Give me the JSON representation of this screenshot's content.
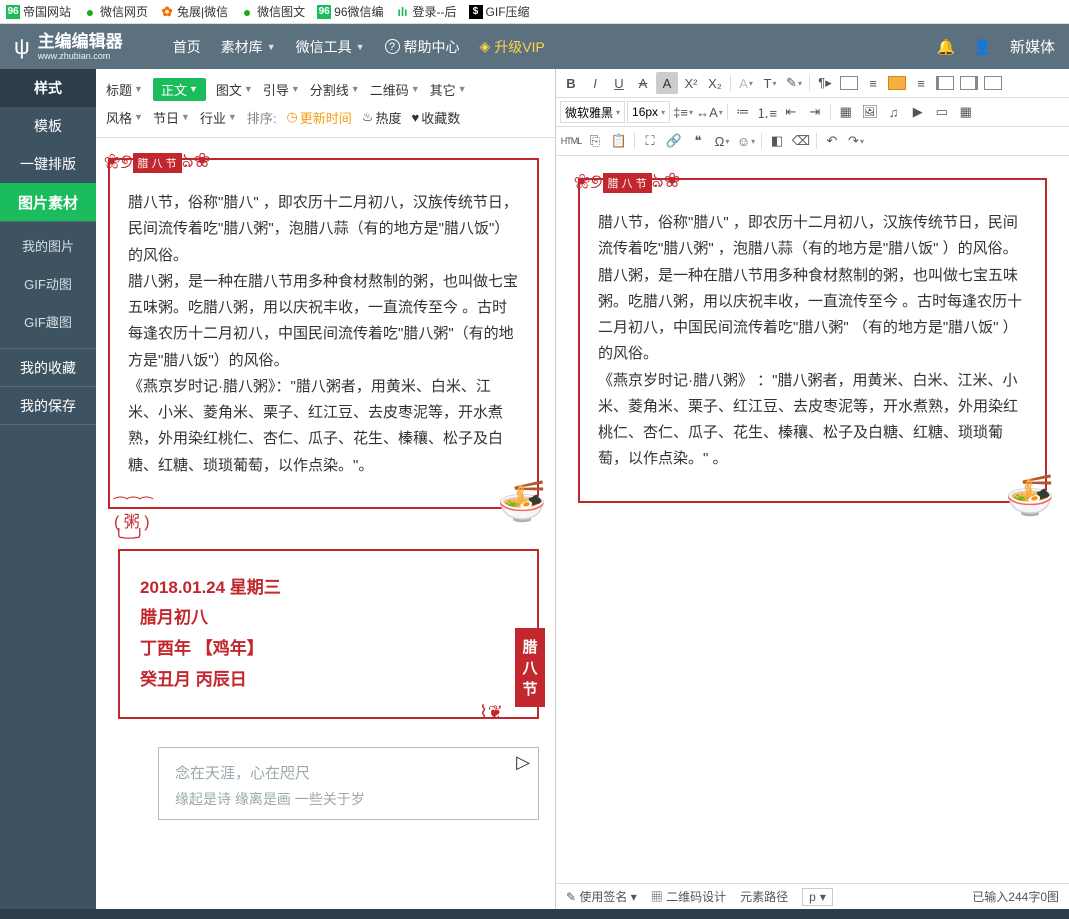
{
  "bookmarks": [
    {
      "label": "帝国网站",
      "icon": "96",
      "cls": "g96"
    },
    {
      "label": "微信网页",
      "icon": "●",
      "cls": "wx"
    },
    {
      "label": "兔展|微信",
      "icon": "✿",
      "cls": "or"
    },
    {
      "label": "微信图文",
      "icon": "●",
      "cls": "wx"
    },
    {
      "label": "96微信编",
      "icon": "96",
      "cls": "g96"
    },
    {
      "label": "登录--后",
      "icon": "ılı",
      "cls": "bars"
    },
    {
      "label": "GIF压缩",
      "icon": "$",
      "cls": "blk"
    }
  ],
  "brand": {
    "title": "主编编辑器",
    "sub": "www.zhubian.com"
  },
  "nav": {
    "home": "首页",
    "materials": "素材库",
    "wxtools": "微信工具",
    "help": "帮助中心",
    "vip": "升级VIP",
    "newmedia": "新媒体"
  },
  "sidebar": {
    "style": "样式",
    "template": "模板",
    "layout": "一键排版",
    "imgmat": "图片素材",
    "myimg": "我的图片",
    "gifanim": "GIF动图",
    "giffun": "GIF趣图",
    "fav": "我的收藏",
    "save": "我的保存"
  },
  "filters": {
    "row1": [
      "标题",
      "正文",
      "图文",
      "引导",
      "分割线",
      "二维码",
      "其它"
    ],
    "row2": {
      "style": "风格",
      "holiday": "节日",
      "industry": "行业",
      "sort": "排序:",
      "time": "更新时间",
      "hot": "热度",
      "fav": "收藏数"
    },
    "clock": "◷",
    "fire": "♨",
    "heart": "♥"
  },
  "laba": {
    "badge": "腊 八 节",
    "p1": "腊八节，俗称\"腊八\" ，即农历十二月初八，汉族传统节日，民间流传着吃\"腊八粥\"，泡腊八蒜（有的地方是\"腊八饭\"）的风俗。",
    "p2": "腊八粥，是一种在腊八节用多种食材熬制的粥，也叫做七宝五味粥。吃腊八粥，用以庆祝丰收，一直流传至今 。古时每逢农历十二月初八，中国民间流传着吃\"腊八粥\"（有的地方是\"腊八饭\"）的风俗。",
    "p3": "《燕京岁时记·腊八粥》：\"腊八粥者，用黄米、白米、江米、小米、菱角米、栗子、红江豆、去皮枣泥等，开水煮熟，外用染红桃仁、杏仁、瓜子、花生、榛穰、松子及白糖、红糖、琐琐葡萄，以作点染。\"。",
    "badge_w": "腊 八 节"
  },
  "datecard": {
    "l1": "2018.01.24 星期三",
    "l2": "腊月初八",
    "l3": "丁酉年 【鸡年】",
    "l4": "癸丑月 丙辰日",
    "v1": "腊",
    "v2": "八",
    "v3": "节"
  },
  "poem": {
    "l1": "念在天涯，心在咫尺",
    "l2": "缘起是诗   缘离是画   一些关于岁"
  },
  "laba_edit": {
    "p1": "腊八节，俗称\"腊八\"  ，即农历十二月初八，汉族传统节日，民间流传着吃\"腊八粥\"  ，泡腊八蒜（有的地方是\"腊八饭\"  ）的风俗。",
    "p2": "腊八粥，是一种在腊八节用多种食材熬制的粥，也叫做七宝五味粥。吃腊八粥，用以庆祝丰收，一直流传至今 。古时每逢农历十二月初八，中国民间流传着吃\"腊八粥\"  （有的地方是\"腊八饭\"  ）的风俗。",
    "p3": "《燕京岁时记·腊八粥》 ：\"腊八粥者，用黄米、白米、江米、小米、菱角米、栗子、红江豆、去皮枣泥等，开水煮熟，外用染红桃仁、杏仁、瓜子、花生、榛穰、松子及白糖、红糖、琐琐葡萄，以作点染。\"  。"
  },
  "toolbar": {
    "font": "微软雅黑",
    "size": "16px",
    "html": "HTML"
  },
  "status": {
    "sig": "使用签名",
    "qr": "二维码设计",
    "path": "元素路径",
    "p": "p",
    "count": "已输入244字0图"
  }
}
